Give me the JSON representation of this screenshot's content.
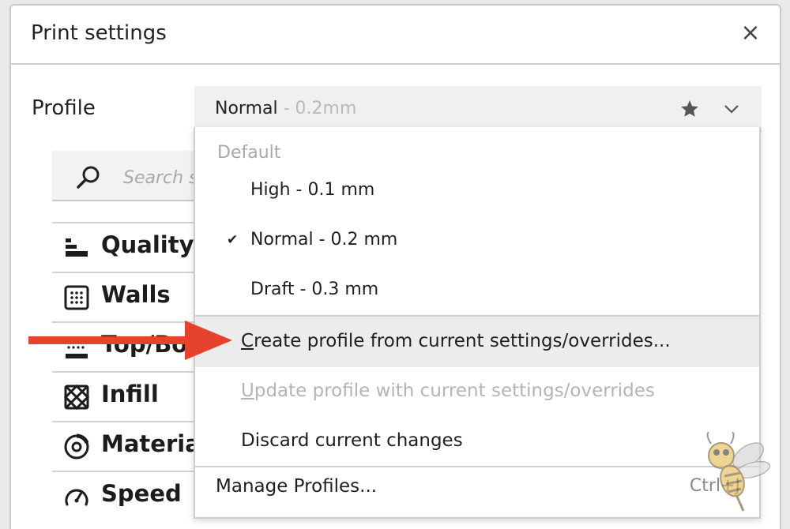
{
  "window": {
    "title": "Print settings",
    "close_label": "×"
  },
  "profile": {
    "label": "Profile",
    "selected_name": "Normal",
    "selected_suffix": " - 0.2mm"
  },
  "search": {
    "placeholder": "Search s"
  },
  "categories": [
    {
      "label": "Quality",
      "icon": "quality-icon"
    },
    {
      "label": "Walls",
      "icon": "walls-icon"
    },
    {
      "label": "Top/Bot",
      "icon": "top-bottom-icon"
    },
    {
      "label": "Infill",
      "icon": "infill-icon"
    },
    {
      "label": "Material",
      "icon": "material-icon"
    },
    {
      "label": "Speed",
      "icon": "speed-icon"
    }
  ],
  "dropdown": {
    "section_label": "Default",
    "profiles": [
      {
        "label": "High - 0.1 mm",
        "checked": false
      },
      {
        "label": "Normal - 0.2 mm",
        "checked": true
      },
      {
        "label": "Draft - 0.3 mm",
        "checked": false
      }
    ],
    "check_mark": "✔",
    "actions": {
      "create": {
        "first": "C",
        "rest": "reate profile from current settings/overrides..."
      },
      "update": {
        "first": "U",
        "rest": "pdate profile with current settings/overrides"
      },
      "discard": {
        "label": "Discard current changes"
      }
    },
    "manage": {
      "label": "Manage Profiles...",
      "shortcut": "Ctrl+J"
    }
  },
  "colors": {
    "accent_arrow": "#e5432e",
    "disabled_text": "#b4b4b4",
    "highlight_bg": "#ececec"
  }
}
